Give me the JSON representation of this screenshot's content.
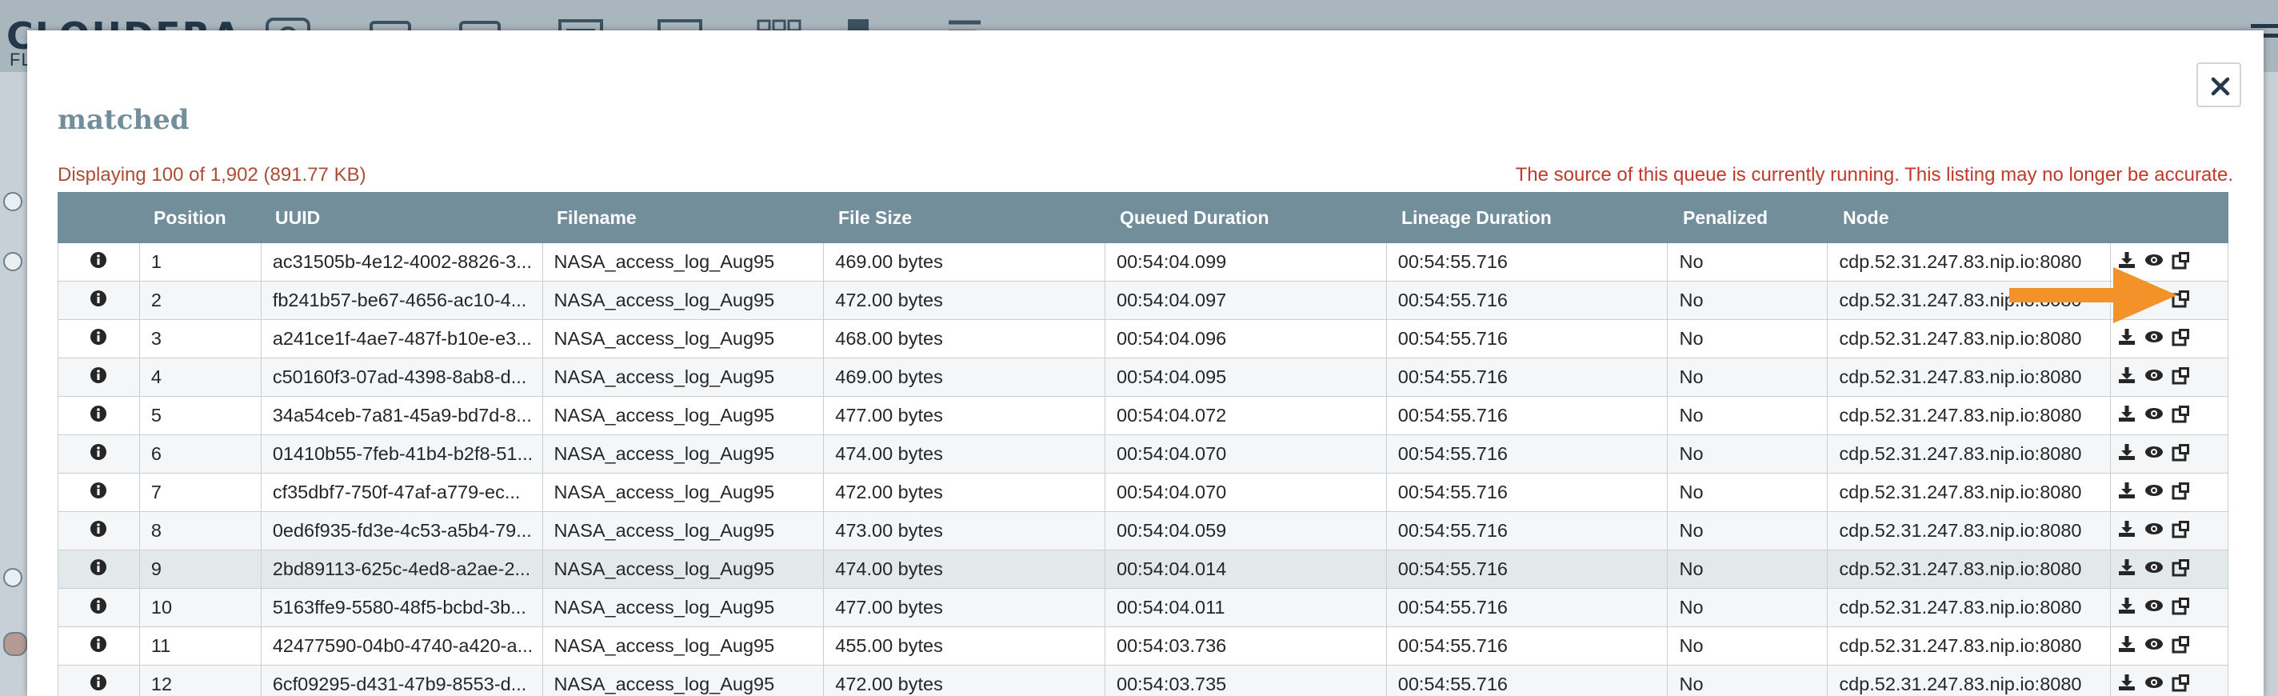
{
  "app": {
    "logo_text": "CLOUDERA",
    "logo_sub": "FL"
  },
  "bg_toolbar_icons": [
    "processor-icon",
    "input-port-icon",
    "output-port-icon",
    "process-group-icon",
    "remote-group-icon",
    "funnel-icon",
    "template-icon",
    "label-icon"
  ],
  "dialog": {
    "title": "matched",
    "summary": "Displaying 100 of 1,902 (891.77 KB)",
    "warning": "The source of this queue is currently running. This listing may no longer be accurate.",
    "close_icon": "close-icon"
  },
  "table": {
    "columns": [
      "",
      "Position",
      "UUID",
      "Filename",
      "File Size",
      "Queued Duration",
      "Lineage Duration",
      "Penalized",
      "Node",
      ""
    ],
    "row_icons": {
      "info": "info-icon",
      "download": "download-icon",
      "view": "eye-icon",
      "provenance": "lineage-icon"
    },
    "rows": [
      {
        "position": "1",
        "uuid": "ac31505b-4e12-4002-8826-3...",
        "filename": "NASA_access_log_Aug95",
        "size": "469.00 bytes",
        "queued": "00:54:04.099",
        "lineage": "00:54:55.716",
        "penalized": "No",
        "node": "cdp.52.31.247.83.nip.io:8080"
      },
      {
        "position": "2",
        "uuid": "fb241b57-be67-4656-ac10-4...",
        "filename": "NASA_access_log_Aug95",
        "size": "472.00 bytes",
        "queued": "00:54:04.097",
        "lineage": "00:54:55.716",
        "penalized": "No",
        "node": "cdp.52.31.247.83.nip.io:8080"
      },
      {
        "position": "3",
        "uuid": "a241ce1f-4ae7-487f-b10e-e3...",
        "filename": "NASA_access_log_Aug95",
        "size": "468.00 bytes",
        "queued": "00:54:04.096",
        "lineage": "00:54:55.716",
        "penalized": "No",
        "node": "cdp.52.31.247.83.nip.io:8080"
      },
      {
        "position": "4",
        "uuid": "c50160f3-07ad-4398-8ab8-d...",
        "filename": "NASA_access_log_Aug95",
        "size": "469.00 bytes",
        "queued": "00:54:04.095",
        "lineage": "00:54:55.716",
        "penalized": "No",
        "node": "cdp.52.31.247.83.nip.io:8080"
      },
      {
        "position": "5",
        "uuid": "34a54ceb-7a81-45a9-bd7d-8...",
        "filename": "NASA_access_log_Aug95",
        "size": "477.00 bytes",
        "queued": "00:54:04.072",
        "lineage": "00:54:55.716",
        "penalized": "No",
        "node": "cdp.52.31.247.83.nip.io:8080"
      },
      {
        "position": "6",
        "uuid": "01410b55-7feb-41b4-b2f8-51...",
        "filename": "NASA_access_log_Aug95",
        "size": "474.00 bytes",
        "queued": "00:54:04.070",
        "lineage": "00:54:55.716",
        "penalized": "No",
        "node": "cdp.52.31.247.83.nip.io:8080"
      },
      {
        "position": "7",
        "uuid": "cf35dbf7-750f-47af-a779-ec...",
        "filename": "NASA_access_log_Aug95",
        "size": "472.00 bytes",
        "queued": "00:54:04.070",
        "lineage": "00:54:55.716",
        "penalized": "No",
        "node": "cdp.52.31.247.83.nip.io:8080"
      },
      {
        "position": "8",
        "uuid": "0ed6f935-fd3e-4c53-a5b4-79...",
        "filename": "NASA_access_log_Aug95",
        "size": "473.00 bytes",
        "queued": "00:54:04.059",
        "lineage": "00:54:55.716",
        "penalized": "No",
        "node": "cdp.52.31.247.83.nip.io:8080"
      },
      {
        "position": "9",
        "uuid": "2bd89113-625c-4ed8-a2ae-2...",
        "filename": "NASA_access_log_Aug95",
        "size": "474.00 bytes",
        "queued": "00:54:04.014",
        "lineage": "00:54:55.716",
        "penalized": "No",
        "node": "cdp.52.31.247.83.nip.io:8080"
      },
      {
        "position": "10",
        "uuid": "5163ffe9-5580-48f5-bcbd-3b...",
        "filename": "NASA_access_log_Aug95",
        "size": "477.00 bytes",
        "queued": "00:54:04.011",
        "lineage": "00:54:55.716",
        "penalized": "No",
        "node": "cdp.52.31.247.83.nip.io:8080"
      },
      {
        "position": "11",
        "uuid": "42477590-04b0-4740-a420-a...",
        "filename": "NASA_access_log_Aug95",
        "size": "455.00 bytes",
        "queued": "00:54:03.736",
        "lineage": "00:54:55.716",
        "penalized": "No",
        "node": "cdp.52.31.247.83.nip.io:8080"
      },
      {
        "position": "12",
        "uuid": "6cf09295-d431-47b9-8553-d...",
        "filename": "NASA_access_log_Aug95",
        "size": "472.00 bytes",
        "queued": "00:54:03.735",
        "lineage": "00:54:55.716",
        "penalized": "No",
        "node": "cdp.52.31.247.83.nip.io:8080"
      }
    ]
  },
  "annotation": {
    "arrow_icon": "orange-pointer-arrow",
    "arrow_color": "#f29229"
  },
  "colors": {
    "header": "#728e9b",
    "title": "#728e9b",
    "summary": "#ab4c35",
    "warning": "#c0392b"
  }
}
